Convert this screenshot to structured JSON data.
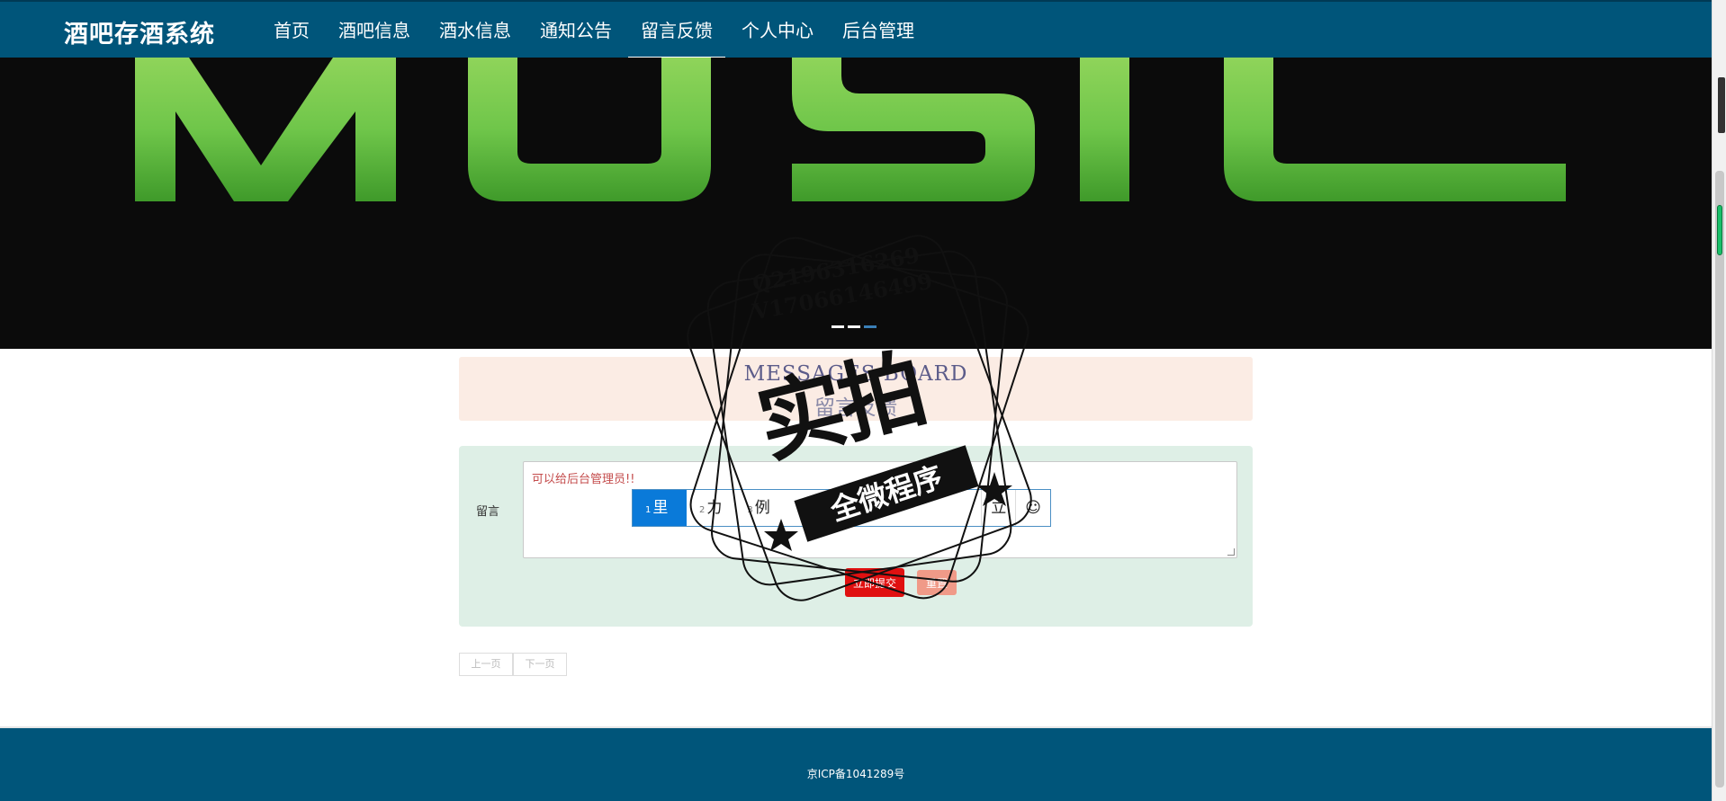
{
  "header": {
    "logo": "酒吧存酒系统",
    "nav": [
      {
        "label": "首页"
      },
      {
        "label": "酒吧信息"
      },
      {
        "label": "酒水信息"
      },
      {
        "label": "通知公告"
      },
      {
        "label": "留言反馈",
        "active": true
      },
      {
        "label": "个人中心"
      },
      {
        "label": "后台管理"
      }
    ]
  },
  "banner": {
    "text": "MUSIC"
  },
  "section": {
    "title_en": "MESSAGES BOARD",
    "title_cn": "留言反馈"
  },
  "form": {
    "label": "留言",
    "textarea_value": "可以给后台管理员!!",
    "submit_label": "立即提交",
    "reset_label": "重置"
  },
  "ime": {
    "candidates": [
      {
        "num": "1",
        "text": "里"
      },
      {
        "num": "2",
        "text": "力"
      },
      {
        "num": "3",
        "text": "例"
      }
    ],
    "tail_char": "立",
    "emoji": "☺"
  },
  "pager": {
    "prev": "上一页",
    "next": "下一页"
  },
  "footer": {
    "icp": "京ICP备1041289号"
  },
  "watermark": {
    "qq": "Q2196316269",
    "vx": "V17066146499",
    "big": "实拍",
    "ribbon": "全微程序"
  },
  "colors": {
    "header": "#00557a",
    "accent_red": "#e01010",
    "banner_green": "#6fc64a"
  }
}
